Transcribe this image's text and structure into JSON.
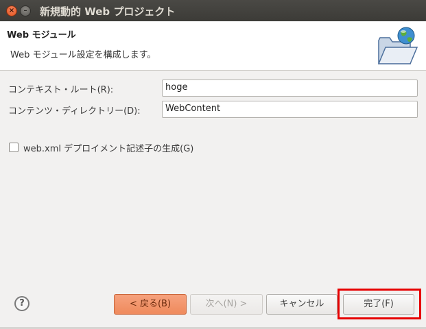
{
  "window": {
    "title": "新規動的 Web プロジェクト",
    "close_glyph": "×",
    "minimize_glyph": "–"
  },
  "banner": {
    "title": "Web モジュール",
    "description": "Web モジュール設定を構成します。",
    "icon": "folder-globe-icon"
  },
  "form": {
    "context_root": {
      "label": "コンテキスト・ルート(R):",
      "value": "hoge"
    },
    "content_dir": {
      "label": "コンテンツ・ディレクトリー(D):",
      "value": "WebContent"
    },
    "generate_xml": {
      "label": "web.xml デプロイメント記述子の生成(G)",
      "checked": false
    }
  },
  "footer": {
    "help_glyph": "?",
    "back_label": "< 戻る(B)",
    "next_label": "次へ(N) >",
    "cancel_label": "キャンセル",
    "finish_label": "完了(F)"
  },
  "colors": {
    "back_button": "#ef8a5c",
    "highlight": "#e60000"
  }
}
